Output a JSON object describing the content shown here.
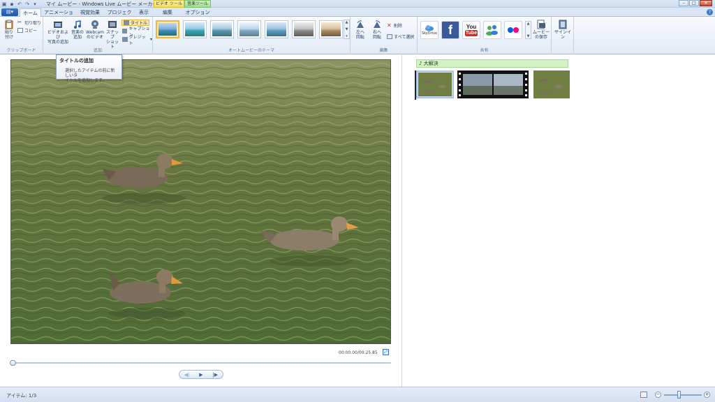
{
  "window": {
    "title": "マイ ムービー - Windows Live ムービー メーカー",
    "context_tabs": {
      "video_tools": "ビデオ ツール",
      "music_tools": "音楽ツール"
    }
  },
  "tabs": [
    {
      "label": "ホーム",
      "active": true
    },
    {
      "label": "アニメーション"
    },
    {
      "label": "視覚効果"
    },
    {
      "label": "プロジェクト"
    },
    {
      "label": "表示"
    },
    {
      "label": "編集"
    },
    {
      "label": "オプション"
    }
  ],
  "ribbon": {
    "clipboard": {
      "label": "クリップボード",
      "paste": "貼り付け",
      "cut": "切り取り",
      "copy": "コピー"
    },
    "add": {
      "label": "追加",
      "add_videos": [
        "ビデオおよび",
        "写真の追加"
      ],
      "add_music": [
        "音楽の",
        "追加"
      ],
      "webcam": [
        "Webcam",
        "のビデオ"
      ],
      "snapshot": [
        "スナップ",
        "ショット"
      ],
      "title": "タイトル",
      "caption": "キャプション",
      "credits": "クレジット"
    },
    "themes": {
      "label": "オートムービーのテーマ",
      "count": 7,
      "selected": 0
    },
    "edit": {
      "label": "編集",
      "rotate_left": [
        "左へ",
        "回転"
      ],
      "rotate_right": [
        "右へ",
        "回転"
      ],
      "delete": "削除",
      "select_all": "すべて選択"
    },
    "share": {
      "label": "共有",
      "skydrive": "SkyDrive",
      "facebook": "f",
      "youtube_top": "You",
      "youtube_bottom": "Tube",
      "save_movie": [
        "ムービー",
        "の保存"
      ]
    },
    "signin": "サインイン"
  },
  "tooltip": {
    "title": "タイトルの追加",
    "body": [
      "選択したアイテムの前に新しいタ",
      "イトルを追加します。"
    ]
  },
  "preview": {
    "time": "00:00.00/00:25.85",
    "playback_position": 0
  },
  "storyboard": {
    "music_title": "大解決",
    "clips": 3
  },
  "status": {
    "items": "アイテム: 1/3"
  },
  "colors": {
    "accent": "#1e54a3",
    "ribbon_bg": "#e2ebf6",
    "music_bar": "#d4f3c5",
    "selection": "#f0b445"
  }
}
